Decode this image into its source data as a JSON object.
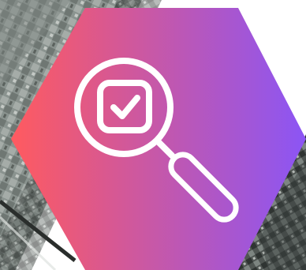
{
  "graphic": {
    "icon": "magnifier-check-icon",
    "background": "aerial-photo-texture",
    "gradient": {
      "start": "#ff5a5f",
      "end": "#8b55f5"
    },
    "icon_color": "#ffffff"
  }
}
